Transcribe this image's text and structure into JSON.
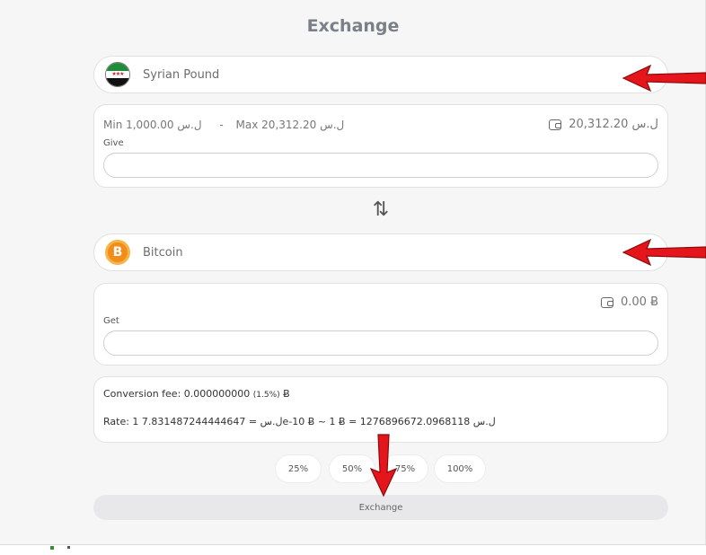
{
  "page": {
    "title": "Exchange"
  },
  "from": {
    "currency_name": "Syrian Pound",
    "flag_stars": "★★★",
    "limits": {
      "min": "Min 1,000.00 ل.س",
      "separator": "-",
      "max": "Max 20,312.20 ل.س"
    },
    "balance": "20,312.20 ل.س",
    "field_label": "Give",
    "value": "",
    "placeholder": ""
  },
  "to": {
    "currency_name": "Bitcoin",
    "icon_glyph": "B",
    "balance": "0.00 Ƀ",
    "field_label": "Get",
    "value": "",
    "placeholder": ""
  },
  "swap_icon": "swap-vertical-arrows-icon",
  "swap_glyph": "⇅",
  "info": {
    "fee_prefix": "Conversion fee: 0.000000000",
    "fee_pct": "(1.5%)",
    "fee_unit": "Ƀ",
    "rate": "Rate: 1 ل.س = 7.831487244444647e-10 Ƀ ~ 1 Ƀ = 1276896672.0968118 ل.س"
  },
  "percent_buttons": [
    "25%",
    "50%",
    "75%",
    "100%"
  ],
  "exchange_label": "Exchange",
  "colors": {
    "annotation_arrow": "#e4161b",
    "bitcoin": "#f28c1a",
    "flag_green": "#1f8c3a"
  }
}
